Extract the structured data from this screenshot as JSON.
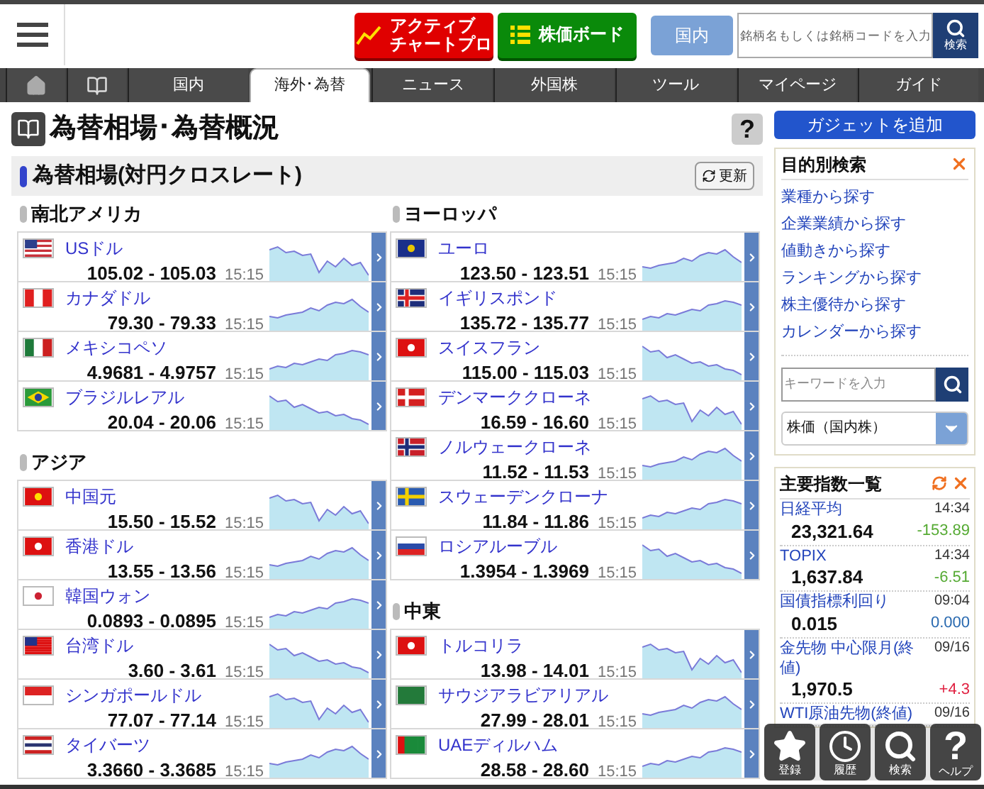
{
  "header": {
    "buttons": [
      {
        "kind": "chart",
        "lines": [
          "アクティブ",
          "チャートプロ"
        ]
      },
      {
        "kind": "board",
        "lines": [
          "株価ボード"
        ]
      }
    ],
    "market_button": "国内",
    "search": {
      "placeholder": "銘柄名もしくは銘柄コードを入力",
      "button": "検索"
    }
  },
  "nav": {
    "tabs": [
      {
        "kind": "home",
        "selected": false
      },
      {
        "kind": "book",
        "selected": false
      },
      {
        "kind": "text",
        "label": "国内",
        "selected": false
      },
      {
        "kind": "text",
        "label": "海外･為替",
        "selected": true
      },
      {
        "kind": "text",
        "label": "ニュース",
        "selected": false
      },
      {
        "kind": "text",
        "label": "外国株",
        "selected": false
      },
      {
        "kind": "text",
        "label": "ツール",
        "selected": false
      },
      {
        "kind": "text",
        "label": "マイページ",
        "selected": false
      },
      {
        "kind": "text",
        "label": "ガイド",
        "selected": false
      }
    ]
  },
  "page_title": "為替相場･為替概況",
  "help": "?",
  "section": {
    "title": "為替相場(対円クロスレート)",
    "refresh": "更新"
  },
  "columns": [
    [
      {
        "region": "南北アメリカ",
        "rates": [
          {
            "name": "USドル",
            "quote": "105.02 - 105.03",
            "time": "15:15"
          },
          {
            "name": "カナダドル",
            "quote": "79.30 - 79.33",
            "time": "15:15"
          },
          {
            "name": "メキシコペソ",
            "quote": "4.9681 - 4.9757",
            "time": "15:15"
          },
          {
            "name": "ブラジルレアル",
            "quote": "20.04 - 20.06",
            "time": "15:15"
          }
        ]
      },
      {
        "region": "アジア",
        "rates": [
          {
            "name": "中国元",
            "quote": "15.50 - 15.52",
            "time": "15:15"
          },
          {
            "name": "香港ドル",
            "quote": "13.55 - 13.56",
            "time": "15:15"
          },
          {
            "name": "韓国ウォン",
            "quote": "0.0893 - 0.0895",
            "time": "15:15"
          },
          {
            "name": "台湾ドル",
            "quote": "3.60 - 3.61",
            "time": "15:15"
          },
          {
            "name": "シンガポールドル",
            "quote": "77.07 - 77.14",
            "time": "15:15"
          },
          {
            "name": "タイバーツ",
            "quote": "3.3660 - 3.3685",
            "time": "15:15"
          }
        ]
      }
    ],
    [
      {
        "region": "ヨーロッパ",
        "rates": [
          {
            "name": "ユーロ",
            "quote": "123.50 - 123.51",
            "time": "15:15"
          },
          {
            "name": "イギリスポンド",
            "quote": "135.72 - 135.77",
            "time": "15:15"
          },
          {
            "name": "スイスフラン",
            "quote": "115.00 - 115.03",
            "time": "15:15"
          },
          {
            "name": "デンマーククローネ",
            "quote": "16.59 - 16.60",
            "time": "15:15"
          },
          {
            "name": "ノルウェークローネ",
            "quote": "11.52 - 11.53",
            "time": "15:15"
          },
          {
            "name": "スウェーデンクローナ",
            "quote": "11.84 - 11.86",
            "time": "15:15"
          },
          {
            "name": "ロシアルーブル",
            "quote": "1.3954 - 1.3969",
            "time": "15:15"
          }
        ]
      },
      {
        "region": "中東",
        "rates": [
          {
            "name": "トルコリラ",
            "quote": "13.98 - 14.01",
            "time": "15:15"
          },
          {
            "name": "サウジアラビアリアル",
            "quote": "27.99 - 28.01",
            "time": "15:15"
          },
          {
            "name": "UAEディルハム",
            "quote": "28.58 - 28.60",
            "time": "15:15"
          }
        ]
      }
    ]
  ],
  "sidebar": {
    "add_button": "ガジェットを追加",
    "search_panel": {
      "title": "目的別検索",
      "links": [
        "業種から探す",
        "企業業績から探す",
        "値動きから探す",
        "ランキングから探す",
        "株主優待から探す",
        "カレンダーから探す"
      ],
      "keyword": {
        "placeholder": "キーワードを入力"
      },
      "select": {
        "value": "株価（国内株）"
      }
    },
    "index_panel": {
      "title": "主要指数一覧",
      "rows": [
        {
          "name": "日経平均",
          "time": "14:34",
          "value": "23,321.64",
          "change": "-153.89",
          "color": "#55aa33"
        },
        {
          "name": "TOPIX",
          "time": "14:34",
          "value": "1,637.84",
          "change": "-6.51",
          "color": "#55aa33"
        },
        {
          "name": "国債指標利回り",
          "time": "09:04",
          "value": "0.015",
          "change": "0.000",
          "color": "#2a6ab0"
        },
        {
          "name": "金先物 中心限月(終値)",
          "time": "09/16",
          "value": "1,970.5",
          "change": "+4.3",
          "color": "#e02040"
        },
        {
          "name": "WTI原油先物(終値)",
          "time": "09/16"
        }
      ]
    }
  },
  "toolbar": [
    {
      "kind": "star",
      "label": "登録"
    },
    {
      "kind": "clock",
      "label": "履歴"
    },
    {
      "kind": "search",
      "label": "検索"
    },
    {
      "kind": "help",
      "symbol": "?",
      "label": "ヘルプ"
    }
  ]
}
